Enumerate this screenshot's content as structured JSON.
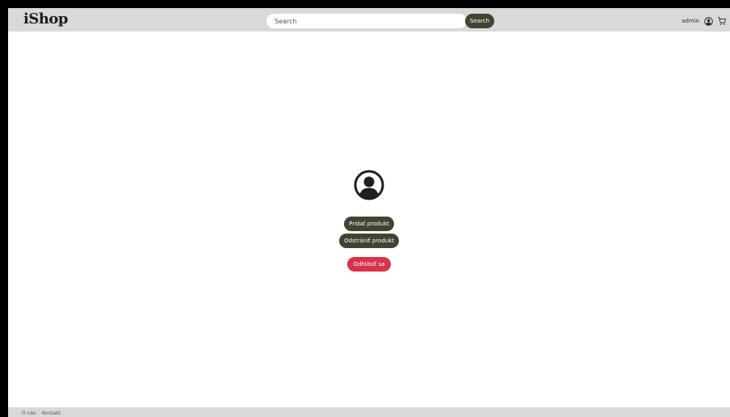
{
  "header": {
    "logo": "iShop",
    "search": {
      "placeholder": "Search",
      "value": ""
    },
    "search_button": "Search",
    "username": "admin",
    "icons": [
      "user-icon",
      "cart-icon"
    ]
  },
  "main": {
    "avatar_icon": "user-icon",
    "buttons": {
      "add_product": "Pridať produkt",
      "remove_product": "Odstrániť produkt",
      "logout": "Odhlásiť sa"
    }
  },
  "footer": {
    "links": [
      "O nás",
      "Kontakt"
    ]
  },
  "colors": {
    "header_bg": "#d9d9d9",
    "primary": "#3e4531",
    "danger": "#d6334a"
  }
}
